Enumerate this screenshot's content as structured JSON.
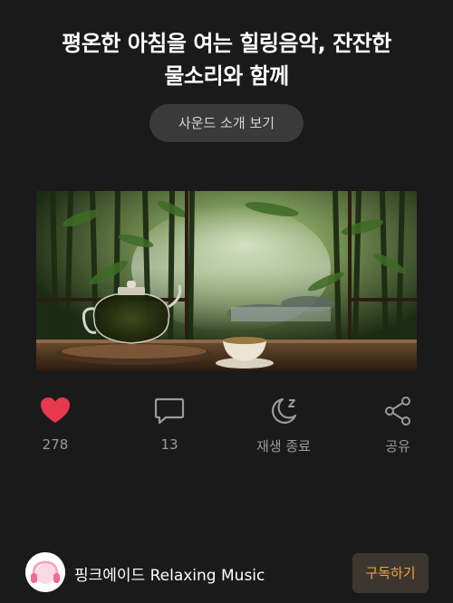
{
  "video": {
    "title_line1": "평온한 아침을 여는 힐링음악, 잔잔한",
    "title_line2": "물소리와 함께",
    "sound_intro_button": "사운드 소개 보기"
  },
  "actions": {
    "like": {
      "icon": "heart-icon",
      "count": "278",
      "color": "#e8384f"
    },
    "comments": {
      "icon": "comment-icon",
      "count": "13"
    },
    "sleep_timer": {
      "icon": "moon-sleep-icon",
      "label": "재생 종료"
    },
    "share": {
      "icon": "share-icon",
      "label": "공유"
    }
  },
  "channel": {
    "name": "핑크에이드 Relaxing Music",
    "subscribe_label": "구독하기",
    "subscribe_color": "#f0a43c"
  }
}
